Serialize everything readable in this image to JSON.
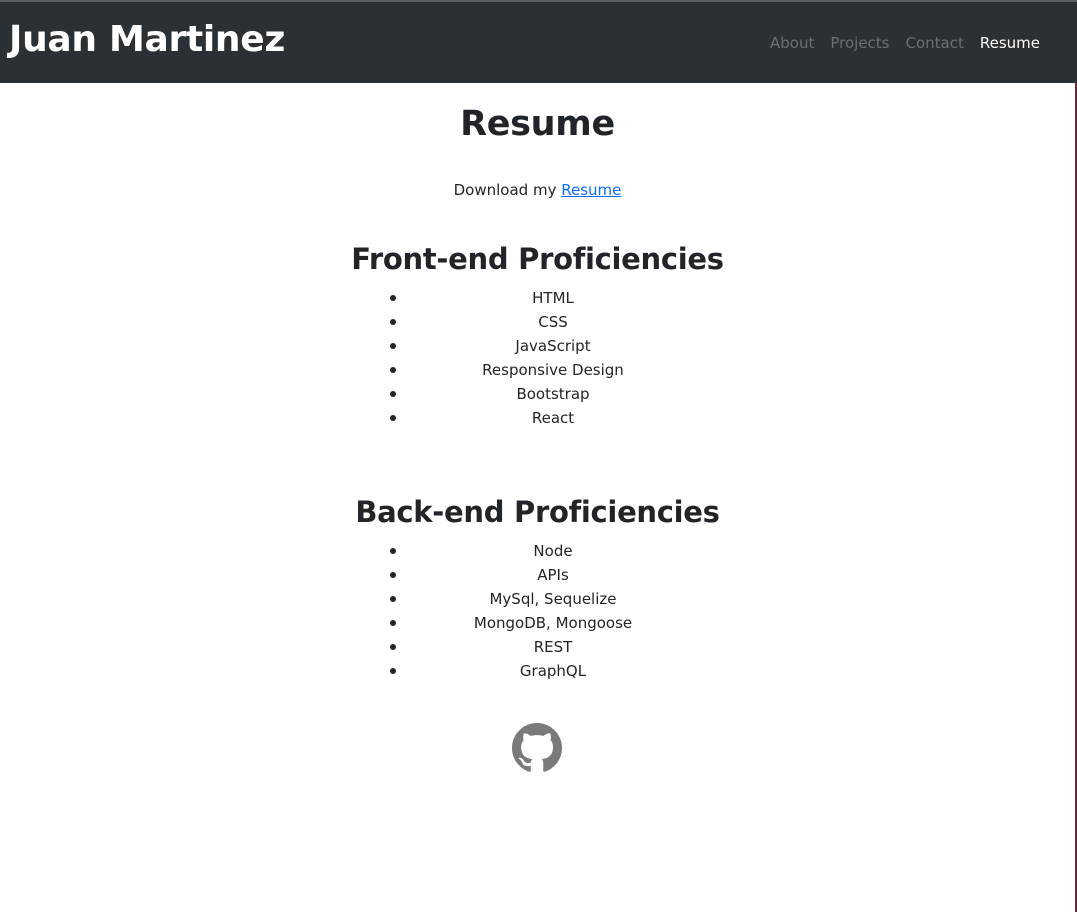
{
  "navbar": {
    "brand": "Juan Martinez",
    "links": [
      {
        "label": "About"
      },
      {
        "label": "Projects"
      },
      {
        "label": "Contact"
      },
      {
        "label": "Resume"
      }
    ]
  },
  "main": {
    "title": "Resume",
    "download_prefix": "Download my ",
    "download_link": "Resume",
    "frontend": {
      "title": "Front-end Proficiencies",
      "items": [
        "HTML",
        "CSS",
        "JavaScript",
        "Responsive Design",
        "Bootstrap",
        "React"
      ]
    },
    "backend": {
      "title": "Back-end Proficiencies",
      "items": [
        "Node",
        "APIs",
        "MySql, Sequelize",
        "MongoDB, Mongoose",
        "REST",
        "GraphQL"
      ]
    }
  },
  "footer": {
    "icon": "github-icon"
  },
  "colors": {
    "navbar_bg": "#2b3035",
    "link": "#0d6efd",
    "text": "#212529",
    "nav_inactive": "#6c6f72",
    "icon": "#7a7a7a"
  }
}
